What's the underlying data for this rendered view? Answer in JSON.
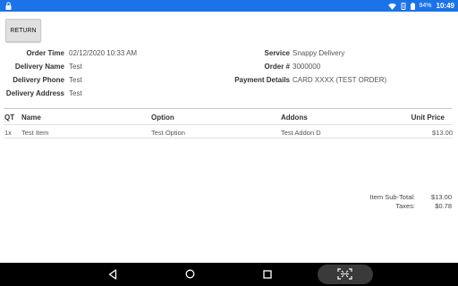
{
  "status_bar": {
    "battery": "94%",
    "time": "10:49",
    "icons": [
      "lock-icon",
      "wifi-icon",
      "vibrate-icon",
      "battery-icon"
    ]
  },
  "return_button": {
    "label": "RETURN"
  },
  "order_info": {
    "left": [
      {
        "label": "Order Time",
        "value": "02/12/2020 10:33 AM"
      },
      {
        "label": "Delivery Name",
        "value": "Test"
      },
      {
        "label": "Delivery Phone",
        "value": "Test"
      },
      {
        "label": "Delivery Address",
        "value": "Test"
      }
    ],
    "right": [
      {
        "label": "Service",
        "value": "Snappy Delivery"
      },
      {
        "label": "Order #",
        "value": "3000000"
      },
      {
        "label": "Payment Details",
        "value": "CARD XXXX (TEST ORDER)"
      }
    ]
  },
  "table": {
    "headers": {
      "qty": "QT",
      "name": "Name",
      "option": "Option",
      "addons": "Addons",
      "price": "Unit Price"
    },
    "rows": [
      {
        "qty": "1x",
        "name": "Test Item",
        "option": "Test Option",
        "addons": "Test Addon D",
        "price": "$13.00"
      }
    ]
  },
  "totals": {
    "subtotal_label": "Item Sub-Total:",
    "subtotal_value": "$13.00",
    "taxes_label": "Taxes:",
    "taxes_value": "$0.78"
  },
  "nav_bar": {
    "icons": [
      "back-icon",
      "home-icon",
      "recents-icon",
      "scan-icon"
    ]
  },
  "colors": {
    "status_bar": "#1a73e8",
    "nav_bar": "#000000",
    "button": "#e0e0e0"
  }
}
